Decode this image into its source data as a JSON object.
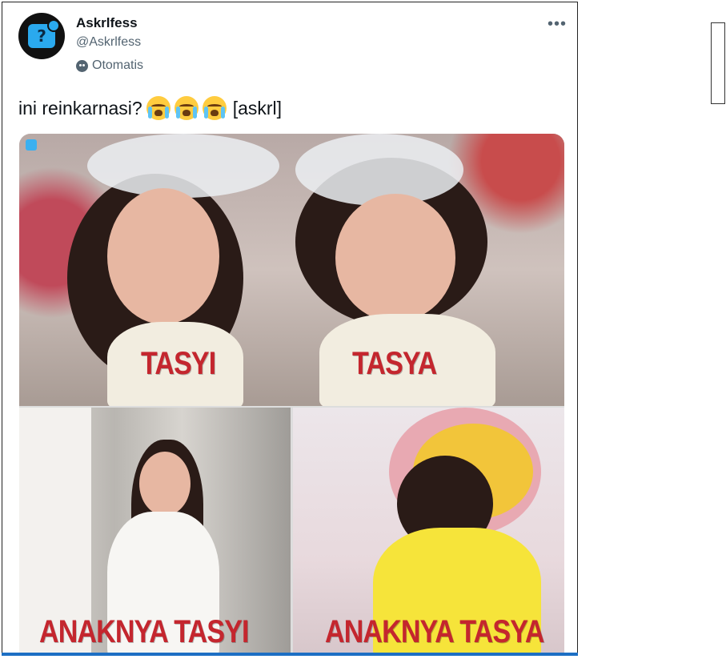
{
  "tweet": {
    "display_name": "Askrlfess",
    "handle": "@Askrlfess",
    "automated_label": "Otomatis",
    "text_before": "ini reinkarnasi?",
    "emojis": [
      "loudly-crying-face",
      "loudly-crying-face",
      "loudly-crying-face"
    ],
    "text_after": "[askrl]",
    "more_icon": "more-horizontal-icon"
  },
  "media": {
    "top_labels": [
      "TASYI",
      "TASYA"
    ],
    "bottom_left_label": "ANAKNYA TASYI",
    "bottom_right_label": "ANAKNYA TASYA",
    "label_color": "#c4262e"
  },
  "colors": {
    "accent_bar": "#1d6fc4",
    "secondary_text": "#536471"
  }
}
